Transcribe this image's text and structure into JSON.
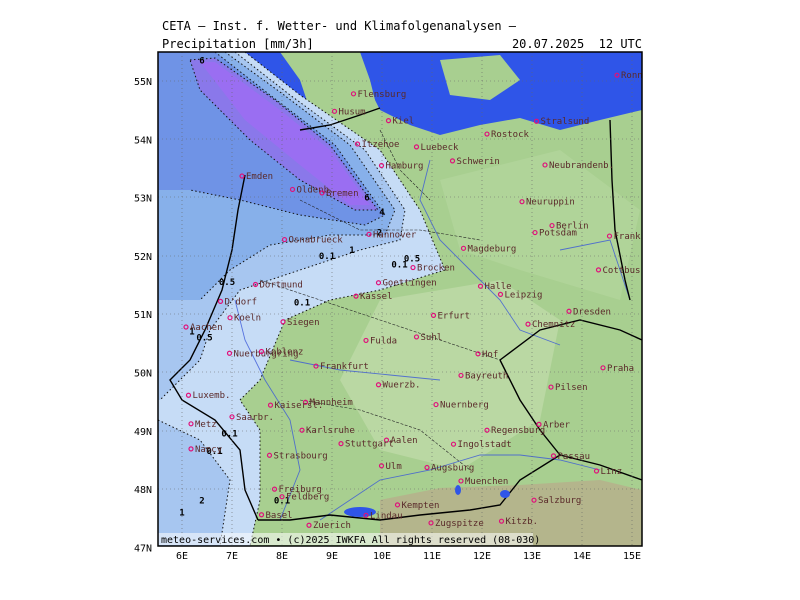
{
  "header": {
    "title": "CETA — Inst. f. Wetter- und Klimafolgenanalysen —",
    "field": "Precipitation [mm/3h]",
    "datetime": "20.07.2025  12 UTC"
  },
  "footer": {
    "credit": "meteo-services.com • (c)2025 IWKFA All rights reserved (08-030)"
  },
  "axes": {
    "lat_labels": [
      "55N",
      "54N",
      "53N",
      "52N",
      "51N",
      "50N",
      "49N",
      "48N",
      "47N"
    ],
    "lon_labels": [
      "6E",
      "7E",
      "8E",
      "9E",
      "10E",
      "11E",
      "12E",
      "13E",
      "14E",
      "15E"
    ]
  },
  "cities": [
    {
      "name": "Flensburg",
      "lon": 9.43,
      "lat": 54.78
    },
    {
      "name": "Husum",
      "lon": 9.05,
      "lat": 54.48
    },
    {
      "name": "Kiel",
      "lon": 10.13,
      "lat": 54.32
    },
    {
      "name": "Itzehoe",
      "lon": 9.51,
      "lat": 53.92
    },
    {
      "name": "Luebeck",
      "lon": 10.69,
      "lat": 53.87
    },
    {
      "name": "Rostock",
      "lon": 12.1,
      "lat": 54.09
    },
    {
      "name": "Stralsund",
      "lon": 13.09,
      "lat": 54.31
    },
    {
      "name": "Ronne",
      "lon": 14.7,
      "lat": 55.1
    },
    {
      "name": "Schwerin",
      "lon": 11.41,
      "lat": 53.63
    },
    {
      "name": "Neubrandenb.",
      "lon": 13.26,
      "lat": 53.56
    },
    {
      "name": "Hamburg",
      "lon": 9.99,
      "lat": 53.55
    },
    {
      "name": "Emden",
      "lon": 7.2,
      "lat": 53.37
    },
    {
      "name": "Oldenb.",
      "lon": 8.21,
      "lat": 53.14
    },
    {
      "name": "Bremen",
      "lon": 8.8,
      "lat": 53.08
    },
    {
      "name": "Neuruppin",
      "lon": 12.8,
      "lat": 52.93
    },
    {
      "name": "Berlin",
      "lon": 13.4,
      "lat": 52.52
    },
    {
      "name": "Potsdam",
      "lon": 13.06,
      "lat": 52.4
    },
    {
      "name": "Frankfurt/O.",
      "lon": 14.55,
      "lat": 52.34
    },
    {
      "name": "Osnabrueck",
      "lon": 8.05,
      "lat": 52.28
    },
    {
      "name": "Hannover",
      "lon": 9.74,
      "lat": 52.37
    },
    {
      "name": "Magdeburg",
      "lon": 11.63,
      "lat": 52.13
    },
    {
      "name": "Brocken",
      "lon": 10.62,
      "lat": 51.8
    },
    {
      "name": "Cottbus",
      "lon": 14.33,
      "lat": 51.76
    },
    {
      "name": "Dortmund",
      "lon": 7.47,
      "lat": 51.51
    },
    {
      "name": "Goettingen",
      "lon": 9.93,
      "lat": 51.54
    },
    {
      "name": "Halle",
      "lon": 11.97,
      "lat": 51.48
    },
    {
      "name": "Leipzig",
      "lon": 12.37,
      "lat": 51.34
    },
    {
      "name": "Kassel",
      "lon": 9.48,
      "lat": 51.31
    },
    {
      "name": "D'dorf",
      "lon": 6.77,
      "lat": 51.22
    },
    {
      "name": "Dresden",
      "lon": 13.74,
      "lat": 51.05
    },
    {
      "name": "Koeln",
      "lon": 6.96,
      "lat": 50.94
    },
    {
      "name": "Siegen",
      "lon": 8.02,
      "lat": 50.87
    },
    {
      "name": "Erfurt",
      "lon": 11.03,
      "lat": 50.98
    },
    {
      "name": "Chemnitz",
      "lon": 12.92,
      "lat": 50.83
    },
    {
      "name": "Aachen",
      "lon": 6.08,
      "lat": 50.78
    },
    {
      "name": "Fulda",
      "lon": 9.68,
      "lat": 50.55
    },
    {
      "name": "Suhl",
      "lon": 10.69,
      "lat": 50.61
    },
    {
      "name": "Hof",
      "lon": 11.92,
      "lat": 50.32
    },
    {
      "name": "Nuerburgring",
      "lon": 6.95,
      "lat": 50.33
    },
    {
      "name": "Koblenz",
      "lon": 7.59,
      "lat": 50.36
    },
    {
      "name": "Frankfurt",
      "lon": 8.68,
      "lat": 50.11
    },
    {
      "name": "Praha",
      "lon": 14.42,
      "lat": 50.08
    },
    {
      "name": "Bayreuth",
      "lon": 11.58,
      "lat": 49.95
    },
    {
      "name": "Wuerzb.",
      "lon": 9.93,
      "lat": 49.79
    },
    {
      "name": "Luxemb.",
      "lon": 6.13,
      "lat": 49.61
    },
    {
      "name": "Pilsen",
      "lon": 13.38,
      "lat": 49.75
    },
    {
      "name": "Mannheim",
      "lon": 8.47,
      "lat": 49.49
    },
    {
      "name": "Kaisersl.",
      "lon": 7.77,
      "lat": 49.44
    },
    {
      "name": "Nuernberg",
      "lon": 11.08,
      "lat": 49.45
    },
    {
      "name": "Saarbr.",
      "lon": 7.0,
      "lat": 49.24
    },
    {
      "name": "Metz",
      "lon": 6.18,
      "lat": 49.12
    },
    {
      "name": "Karlsruhe",
      "lon": 8.4,
      "lat": 49.01
    },
    {
      "name": "Regensburg",
      "lon": 12.1,
      "lat": 49.01
    },
    {
      "name": "Arber",
      "lon": 13.14,
      "lat": 49.11
    },
    {
      "name": "Aalen",
      "lon": 10.09,
      "lat": 48.84
    },
    {
      "name": "Ingolstadt",
      "lon": 11.43,
      "lat": 48.77
    },
    {
      "name": "Stuttgart",
      "lon": 9.18,
      "lat": 48.78
    },
    {
      "name": "Nancy",
      "lon": 6.18,
      "lat": 48.69
    },
    {
      "name": "Strasbourg",
      "lon": 7.75,
      "lat": 48.58
    },
    {
      "name": "Passau",
      "lon": 13.43,
      "lat": 48.57
    },
    {
      "name": "Ulm",
      "lon": 9.99,
      "lat": 48.4
    },
    {
      "name": "Augsburg",
      "lon": 10.9,
      "lat": 48.37
    },
    {
      "name": "Linz",
      "lon": 14.29,
      "lat": 48.31
    },
    {
      "name": "Muenchen",
      "lon": 11.58,
      "lat": 48.14
    },
    {
      "name": "Freiburg",
      "lon": 7.85,
      "lat": 48.0
    },
    {
      "name": "Feldberg",
      "lon": 8.0,
      "lat": 47.87
    },
    {
      "name": "Salzburg",
      "lon": 13.04,
      "lat": 47.81
    },
    {
      "name": "Kempten",
      "lon": 10.31,
      "lat": 47.73
    },
    {
      "name": "Basel",
      "lon": 7.59,
      "lat": 47.56
    },
    {
      "name": "Zuerich",
      "lon": 8.54,
      "lat": 47.38
    },
    {
      "name": "Lindau",
      "lon": 9.68,
      "lat": 47.55
    },
    {
      "name": "Zugspitze",
      "lon": 10.98,
      "lat": 47.42
    },
    {
      "name": "Kitzb.",
      "lon": 12.39,
      "lat": 47.45
    }
  ],
  "contour_labels": [
    {
      "text": "6",
      "lon": 6.4,
      "lat": 55.3
    },
    {
      "text": "6",
      "lon": 9.7,
      "lat": 52.95
    },
    {
      "text": "4",
      "lon": 10.0,
      "lat": 52.7
    },
    {
      "text": "2",
      "lon": 9.95,
      "lat": 52.35
    },
    {
      "text": "1",
      "lon": 9.4,
      "lat": 52.05
    },
    {
      "text": "0.1",
      "lon": 8.9,
      "lat": 51.95
    },
    {
      "text": "0.1",
      "lon": 10.35,
      "lat": 51.8
    },
    {
      "text": "0.5",
      "lon": 10.6,
      "lat": 51.9
    },
    {
      "text": "0.5",
      "lon": 6.9,
      "lat": 51.5
    },
    {
      "text": "0.1",
      "lon": 8.4,
      "lat": 51.15
    },
    {
      "text": "0.5",
      "lon": 6.45,
      "lat": 50.55
    },
    {
      "text": "1",
      "lon": 6.2,
      "lat": 50.65
    },
    {
      "text": "0.1",
      "lon": 6.95,
      "lat": 48.9
    },
    {
      "text": "0.1",
      "lon": 6.65,
      "lat": 48.6
    },
    {
      "text": "0.1",
      "lon": 8.0,
      "lat": 47.75
    },
    {
      "text": "2",
      "lon": 6.4,
      "lat": 47.75
    },
    {
      "text": "1",
      "lon": 6.0,
      "lat": 47.55
    }
  ],
  "colors": {
    "land_green": "#a8cf90",
    "land_light": "#bedaa8",
    "sea": "#2f55e8",
    "precip_0_1": "#c6dcf6",
    "precip_0_5": "#a7c6f0",
    "precip_1": "#87b0ea",
    "precip_2": "#6f93e6",
    "precip_4": "#8a78ea",
    "precip_6": "#9a6ef2",
    "city_dot": "#e0107a"
  },
  "legend_icons": {
    "city_marker": "city-dot-icon"
  }
}
